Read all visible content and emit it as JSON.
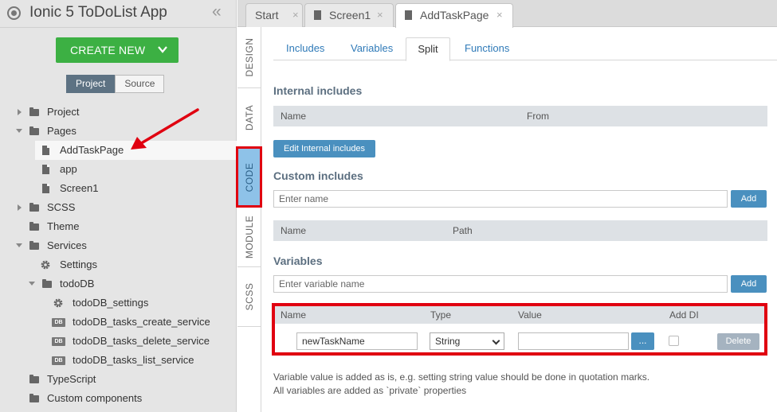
{
  "app": {
    "title": "Ionic 5 ToDoList App",
    "collapse_icon": "double-chevron-left-icon",
    "create_new_label": "CREATE NEW",
    "project_tab": "Project",
    "source_tab": "Source"
  },
  "tree": [
    {
      "label": "Project",
      "icon": "folder-icon"
    },
    {
      "label": "Pages",
      "icon": "folder-icon"
    },
    {
      "label": "AddTaskPage",
      "icon": "file-icon"
    },
    {
      "label": "app",
      "icon": "file-icon"
    },
    {
      "label": "Screen1",
      "icon": "file-icon"
    },
    {
      "label": "SCSS",
      "icon": "folder-icon"
    },
    {
      "label": "Theme",
      "icon": "folder-icon"
    },
    {
      "label": "Services",
      "icon": "folder-icon"
    },
    {
      "label": "Settings",
      "icon": "gear-icon"
    },
    {
      "label": "todoDB",
      "icon": "folder-icon"
    },
    {
      "label": "todoDB_settings",
      "icon": "gear-icon"
    },
    {
      "label": "todoDB_tasks_create_service",
      "icon": "db-icon",
      "badge": "DB"
    },
    {
      "label": "todoDB_tasks_delete_service",
      "icon": "db-icon",
      "badge": "DB"
    },
    {
      "label": "todoDB_tasks_list_service",
      "icon": "db-icon",
      "badge": "DB"
    },
    {
      "label": "TypeScript",
      "icon": "folder-icon"
    },
    {
      "label": "Custom components",
      "icon": "folder-icon"
    }
  ],
  "side_tabs": [
    "DESIGN",
    "DATA",
    "CODE",
    "MODULE",
    "SCSS"
  ],
  "file_tabs": [
    {
      "label": "Start",
      "close": "×"
    },
    {
      "label": "Screen1",
      "close": "×"
    },
    {
      "label": "AddTaskPage",
      "close": "×"
    }
  ],
  "sub_tabs": [
    "Includes",
    "Variables",
    "Split",
    "Functions"
  ],
  "internal_includes": {
    "title": "Internal includes",
    "col_name": "Name",
    "col_from": "From",
    "edit_button": "Edit Internal includes"
  },
  "custom_includes": {
    "title": "Custom includes",
    "placeholder": "Enter name",
    "add_button": "Add",
    "col_name": "Name",
    "col_path": "Path"
  },
  "variables": {
    "title": "Variables",
    "placeholder": "Enter variable name",
    "add_button": "Add",
    "col_name": "Name",
    "col_type": "Type",
    "col_value": "Value",
    "col_adddi": "Add DI",
    "row": {
      "name": "newTaskName",
      "type": "String",
      "value": "",
      "more_button": "...",
      "delete_button": "Delete"
    }
  },
  "notes": [
    "Variable value is added as is, e.g. setting string value should be done in quotation marks.",
    "All variables are added as `private` properties"
  ],
  "colors": {
    "accent_green": "#3cb043",
    "accent_blue": "#4a90bf",
    "highlight_red": "#e00010",
    "active_side_tab": "#8ec2e8"
  }
}
